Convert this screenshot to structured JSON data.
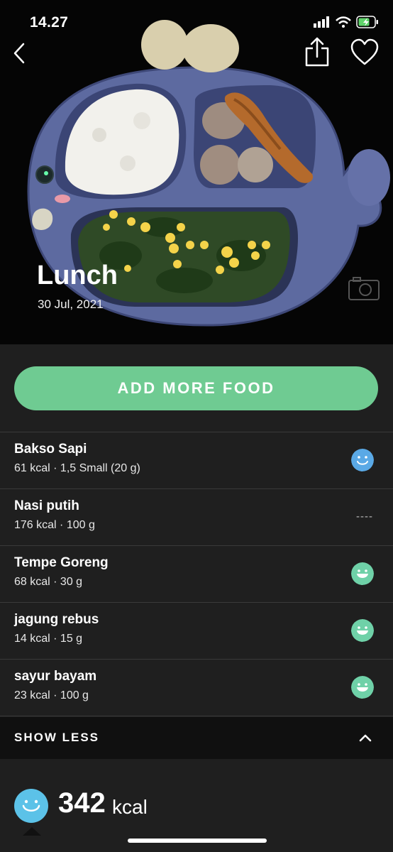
{
  "status_bar": {
    "time": "14.27"
  },
  "header": {
    "meal_name": "Lunch",
    "date": "30 Jul, 2021"
  },
  "actions": {
    "add_more_food": "ADD MORE FOOD",
    "show_less": "SHOW LESS"
  },
  "foods": [
    {
      "name": "Bakso Sapi",
      "meta": "61 kcal · 1,5 Small (20 g)",
      "rating": "smiley-blue-icon"
    },
    {
      "name": "Nasi putih",
      "meta": "176 kcal · 100 g",
      "rating": "none",
      "rating_text": "----"
    },
    {
      "name": "Tempe Goreng",
      "meta": "68 kcal · 30 g",
      "rating": "smiley-green-icon"
    },
    {
      "name": "jagung rebus",
      "meta": "14 kcal · 15 g",
      "rating": "smiley-green-icon"
    },
    {
      "name": "sayur bayam",
      "meta": "23 kcal · 100 g",
      "rating": "smiley-green-icon"
    }
  ],
  "summary": {
    "kcal": "342",
    "unit": "kcal"
  },
  "colors": {
    "accent_green": "#6fcb92",
    "smiley_blue": "#5aa9e6",
    "smiley_green": "#6fd1a8",
    "summary_blue": "#5cc2e8"
  }
}
